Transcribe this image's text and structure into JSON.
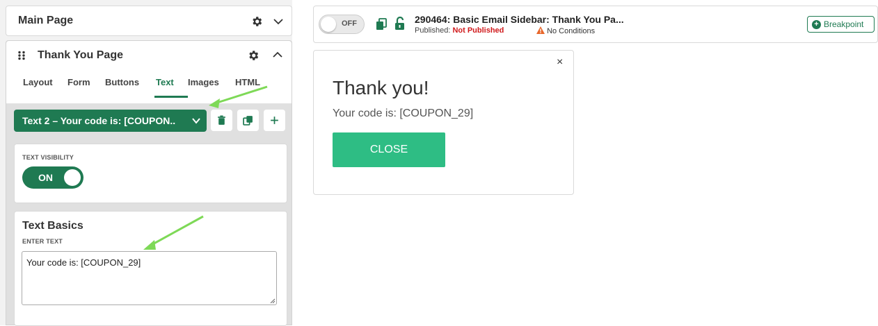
{
  "left_panel": {
    "main_page": {
      "title": "Main Page"
    },
    "thank_you_page": {
      "title": "Thank You Page",
      "tabs": [
        {
          "label": "Layout",
          "active": false
        },
        {
          "label": "Form",
          "active": false
        },
        {
          "label": "Buttons",
          "active": false
        },
        {
          "label": "Text",
          "active": true
        },
        {
          "label": "Images",
          "active": false
        },
        {
          "label": "HTML",
          "active": false
        }
      ],
      "text_select": {
        "value": "Text 2 – Your code is: [COUPON.."
      },
      "visibility": {
        "label": "TEXT VISIBILITY",
        "toggle": "ON"
      },
      "text_basics": {
        "title": "Text Basics",
        "field_label": "ENTER TEXT",
        "value": "Your code is: [COUPON_29]"
      }
    }
  },
  "topbar": {
    "toggle": "OFF",
    "name": "290464: Basic Email Sidebar: Thank You Pa...",
    "published_label": "Published:",
    "published_value": "Not Published",
    "conditions": "No Conditions",
    "breakpoint_label": "Breakpoint"
  },
  "preview": {
    "heading": "Thank you!",
    "code_text": "Your code is: [COUPON_29]",
    "close_button": "CLOSE",
    "close_icon": "×"
  },
  "colors": {
    "brand_green": "#1f7a52",
    "button_green": "#2ebd84",
    "warning_red": "#d0191b",
    "arrow_green": "#7ed957"
  }
}
